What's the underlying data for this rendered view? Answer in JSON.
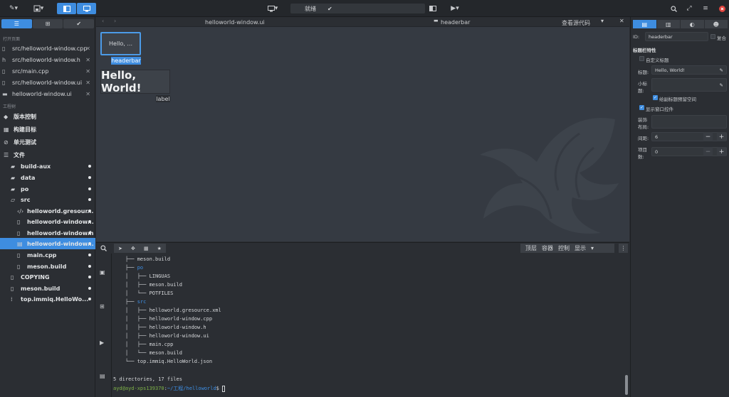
{
  "topbar": {
    "status_label": "就绪"
  },
  "sidebar": {
    "open_pages_header": "打开页面",
    "open_files": [
      {
        "name": "src/helloworld-window.cpp"
      },
      {
        "name": "src/helloworld-window.h"
      },
      {
        "name": "src/main.cpp"
      },
      {
        "name": "src/helloworld-window.ui"
      },
      {
        "name": "helloworld-window.ui"
      }
    ],
    "project_header": "工程树",
    "project_items": [
      {
        "name": "版本控制"
      },
      {
        "name": "构建目标"
      },
      {
        "name": "单元测试"
      },
      {
        "name": "文件"
      },
      {
        "name": "build-aux"
      },
      {
        "name": "data"
      },
      {
        "name": "po"
      },
      {
        "name": "src"
      },
      {
        "name": "helloworld.gresour..."
      },
      {
        "name": "helloworld-window..."
      },
      {
        "name": "helloworld-window.h"
      },
      {
        "name": "helloworld-window..."
      },
      {
        "name": "main.cpp"
      },
      {
        "name": "meson.build"
      },
      {
        "name": "COPYING"
      },
      {
        "name": "meson.build"
      },
      {
        "name": "top.immiq.HelloWo..."
      }
    ]
  },
  "center": {
    "file_title": "helloworld-window.ui",
    "widget_path": "headerbar",
    "view_source_label": "查看源代码",
    "widgets": {
      "headerbar_text": "Hello, ...",
      "headerbar_tag": "headerbar",
      "label_text": "Hello, World!",
      "label_tag": "label"
    }
  },
  "bottom_toolbar": {
    "tabs": [
      "顶层",
      "容器",
      "控制",
      "显示"
    ]
  },
  "terminal": {
    "lines": [
      {
        "tree": "    ├── ",
        "text": "meson.build",
        "dir": false
      },
      {
        "tree": "    ├── ",
        "text": "po",
        "dir": true
      },
      {
        "tree": "    │   ├── ",
        "text": "LINGUAS",
        "dir": false
      },
      {
        "tree": "    │   ├── ",
        "text": "meson.build",
        "dir": false
      },
      {
        "tree": "    │   └── ",
        "text": "POTFILES",
        "dir": false
      },
      {
        "tree": "    ├── ",
        "text": "src",
        "dir": true
      },
      {
        "tree": "    │   ├── ",
        "text": "helloworld.gresource.xml",
        "dir": false
      },
      {
        "tree": "    │   ├── ",
        "text": "helloworld-window.cpp",
        "dir": false
      },
      {
        "tree": "    │   ├── ",
        "text": "helloworld-window.h",
        "dir": false
      },
      {
        "tree": "    │   ├── ",
        "text": "helloworld-window.ui",
        "dir": false
      },
      {
        "tree": "    │   ├── ",
        "text": "main.cpp",
        "dir": false
      },
      {
        "tree": "    │   └── ",
        "text": "meson.build",
        "dir": false
      },
      {
        "tree": "    └── ",
        "text": "top.immiq.HelloWorld.json",
        "dir": false
      }
    ],
    "summary": "5 directories, 17 files",
    "prompt_user": "ayd@ayd-xps139370",
    "prompt_path": "~/工程/helloworld",
    "prompt_suffix": "$ "
  },
  "right_panel": {
    "id_label": "ID:",
    "id_value": "headerbar",
    "composite_label": "复合",
    "section_title": "标题栏特性",
    "custom_title_label": "自定义标题",
    "title_label": "标题:",
    "title_value": "Hello, World!",
    "subtitle_label_1": "小标",
    "subtitle_label_2": "题:",
    "has_subtitle_label": "给副标题预留空间",
    "show_close_label": "显示窗口控件",
    "decoration_label_1": "装饰",
    "decoration_label_2": "布局:",
    "spacing_label": "间距:",
    "spacing_value": "6",
    "items_label_1": "项目",
    "items_label_2": "数:",
    "items_value": "0"
  },
  "colors": {
    "accent": "#3e8de0",
    "dir": "#3d8fe5",
    "user": "#7fb348",
    "close": "#e0443e"
  }
}
